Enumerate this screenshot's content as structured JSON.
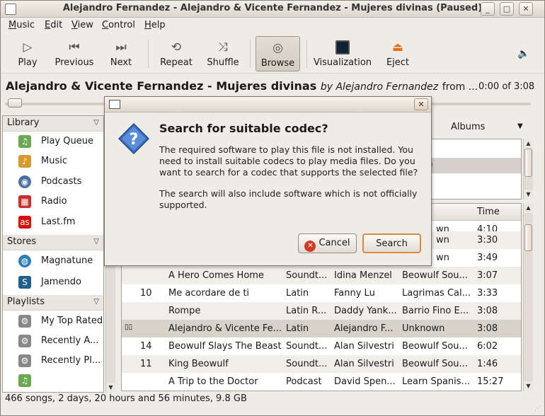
{
  "window": {
    "title": "Alejandro Fernandez - Alejandro & Vicente Fernandez - Mujeres divinas (Paused)",
    "min": "_",
    "max": "□",
    "close": "✕"
  },
  "menu": [
    "Music",
    "Edit",
    "View",
    "Control",
    "Help"
  ],
  "toolbar": {
    "play": "Play",
    "previous": "Previous",
    "next": "Next",
    "repeat": "Repeat",
    "shuffle": "Shuffle",
    "browse": "Browse",
    "visualization": "Visualization",
    "eject": "Eject"
  },
  "now_playing": {
    "title": "Alejandro & Vicente Fernandez - Mujeres divinas",
    "by": "by Alejandro Fernandez",
    "rest": "from ...",
    "time": "0:00 of 3:08"
  },
  "sidebar": {
    "library": "Library",
    "library_items": [
      "Play Queue",
      "Music",
      "Podcasts",
      "Radio",
      "Last.fm"
    ],
    "stores": "Stores",
    "store_items": [
      "Magnatune",
      "Jamendo"
    ],
    "playlists": "Playlists",
    "playlist_items": [
      "My Top Rated",
      "Recently A...",
      "Recently Pl...",
      ""
    ]
  },
  "browser": {
    "partial": "s",
    "albums": "Albums",
    "selected_row_partial": "s)"
  },
  "table": {
    "time_header": "Time",
    "hidden_rows": [
      {
        "album": "wn",
        "time": "4:10"
      },
      {
        "album": "wn",
        "time": "3:30"
      },
      {
        "album": "wn",
        "time": "3:49"
      }
    ],
    "rows": [
      {
        "track": "",
        "title": "A Hero Comes Home",
        "genre": "Soundt...",
        "artist": "Idina Menzel",
        "album": "Beowulf Sou...",
        "time": "3:07"
      },
      {
        "track": "10",
        "title": "Me acordare de ti",
        "genre": "Latin",
        "artist": "Fanny Lu",
        "album": "Lagrimas Cal...",
        "time": "3:33"
      },
      {
        "track": "",
        "title": "Rompe",
        "genre": "Latin R...",
        "artist": "Daddy Yank...",
        "album": "Barrio Fino E...",
        "time": "3:08"
      },
      {
        "track": "▯▯",
        "title": "Alejandro & Vicente Fe...",
        "genre": "Latin",
        "artist": "Alejandro F...",
        "album": "Unknown",
        "time": "3:08"
      },
      {
        "track": "14",
        "title": "Beowulf Slays The Beast",
        "genre": "Soundt...",
        "artist": "Alan Silvestri",
        "album": "Beowulf Sou...",
        "time": "6:02"
      },
      {
        "track": "11",
        "title": "King Beowulf",
        "genre": "Soundt...",
        "artist": "Alan Silvestri",
        "album": "Beowulf Sou...",
        "time": "1:46"
      },
      {
        "track": "",
        "title": "A Trip to the Doctor",
        "genre": "Podcast",
        "artist": "David Spen...",
        "album": "Learn Spanis...",
        "time": "15:27"
      }
    ]
  },
  "status": "466 songs, 2 days, 20 hours and 56 minutes, 9.8 GB",
  "dialog": {
    "close": "✕",
    "heading": "Search for suitable codec?",
    "body1": "The required software to play this file is not installed. You need to install suitable codecs to play media files. Do you want to search for a codec that supports the selected file?",
    "body2": "The search will also include software which is not officially supported.",
    "cancel": "Cancel",
    "search": "Search"
  }
}
